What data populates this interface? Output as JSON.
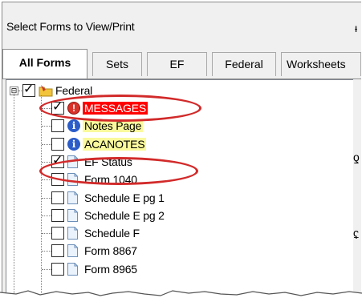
{
  "header": {
    "title": "Select Forms to View/Print"
  },
  "tabs": [
    {
      "label": "All Forms",
      "active": true
    },
    {
      "label": "Sets",
      "active": false
    },
    {
      "label": "EF",
      "active": false
    },
    {
      "label": "Federal",
      "active": false
    },
    {
      "label": "Worksheets",
      "active": false
    }
  ],
  "tree": {
    "root": {
      "label": "Federal",
      "checked": true,
      "expander": "⊟",
      "icon": "folder-icon"
    },
    "items": [
      {
        "label": "MESSAGES",
        "checked": true,
        "icon": "alert-icon",
        "style": "red"
      },
      {
        "label": "Notes Page",
        "checked": false,
        "icon": "info-icon",
        "style": "highlight"
      },
      {
        "label": "ACANOTES",
        "checked": false,
        "icon": "info-icon",
        "style": "highlight"
      },
      {
        "label": "EF Status",
        "checked": true,
        "icon": "document-icon",
        "style": "plain"
      },
      {
        "label": "Form 1040",
        "checked": false,
        "icon": "document-icon",
        "style": "plain"
      },
      {
        "label": "Schedule E pg 1",
        "checked": false,
        "icon": "document-icon",
        "style": "plain"
      },
      {
        "label": "Schedule E pg 2",
        "checked": false,
        "icon": "document-icon",
        "style": "plain"
      },
      {
        "label": "Schedule F",
        "checked": false,
        "icon": "document-icon",
        "style": "plain"
      },
      {
        "label": "Form 8867",
        "checked": false,
        "icon": "document-icon",
        "style": "plain"
      },
      {
        "label": "Form 8965",
        "checked": false,
        "icon": "document-icon",
        "style": "plain"
      }
    ]
  },
  "annotations": {
    "circle_color": "#d22a2a",
    "circled_items": [
      "MESSAGES",
      "EF Status"
    ]
  },
  "colors": {
    "messages_bg": "#ff0000",
    "highlight_bg": "#fafa9c",
    "info_icon": "#2b5cc8"
  }
}
